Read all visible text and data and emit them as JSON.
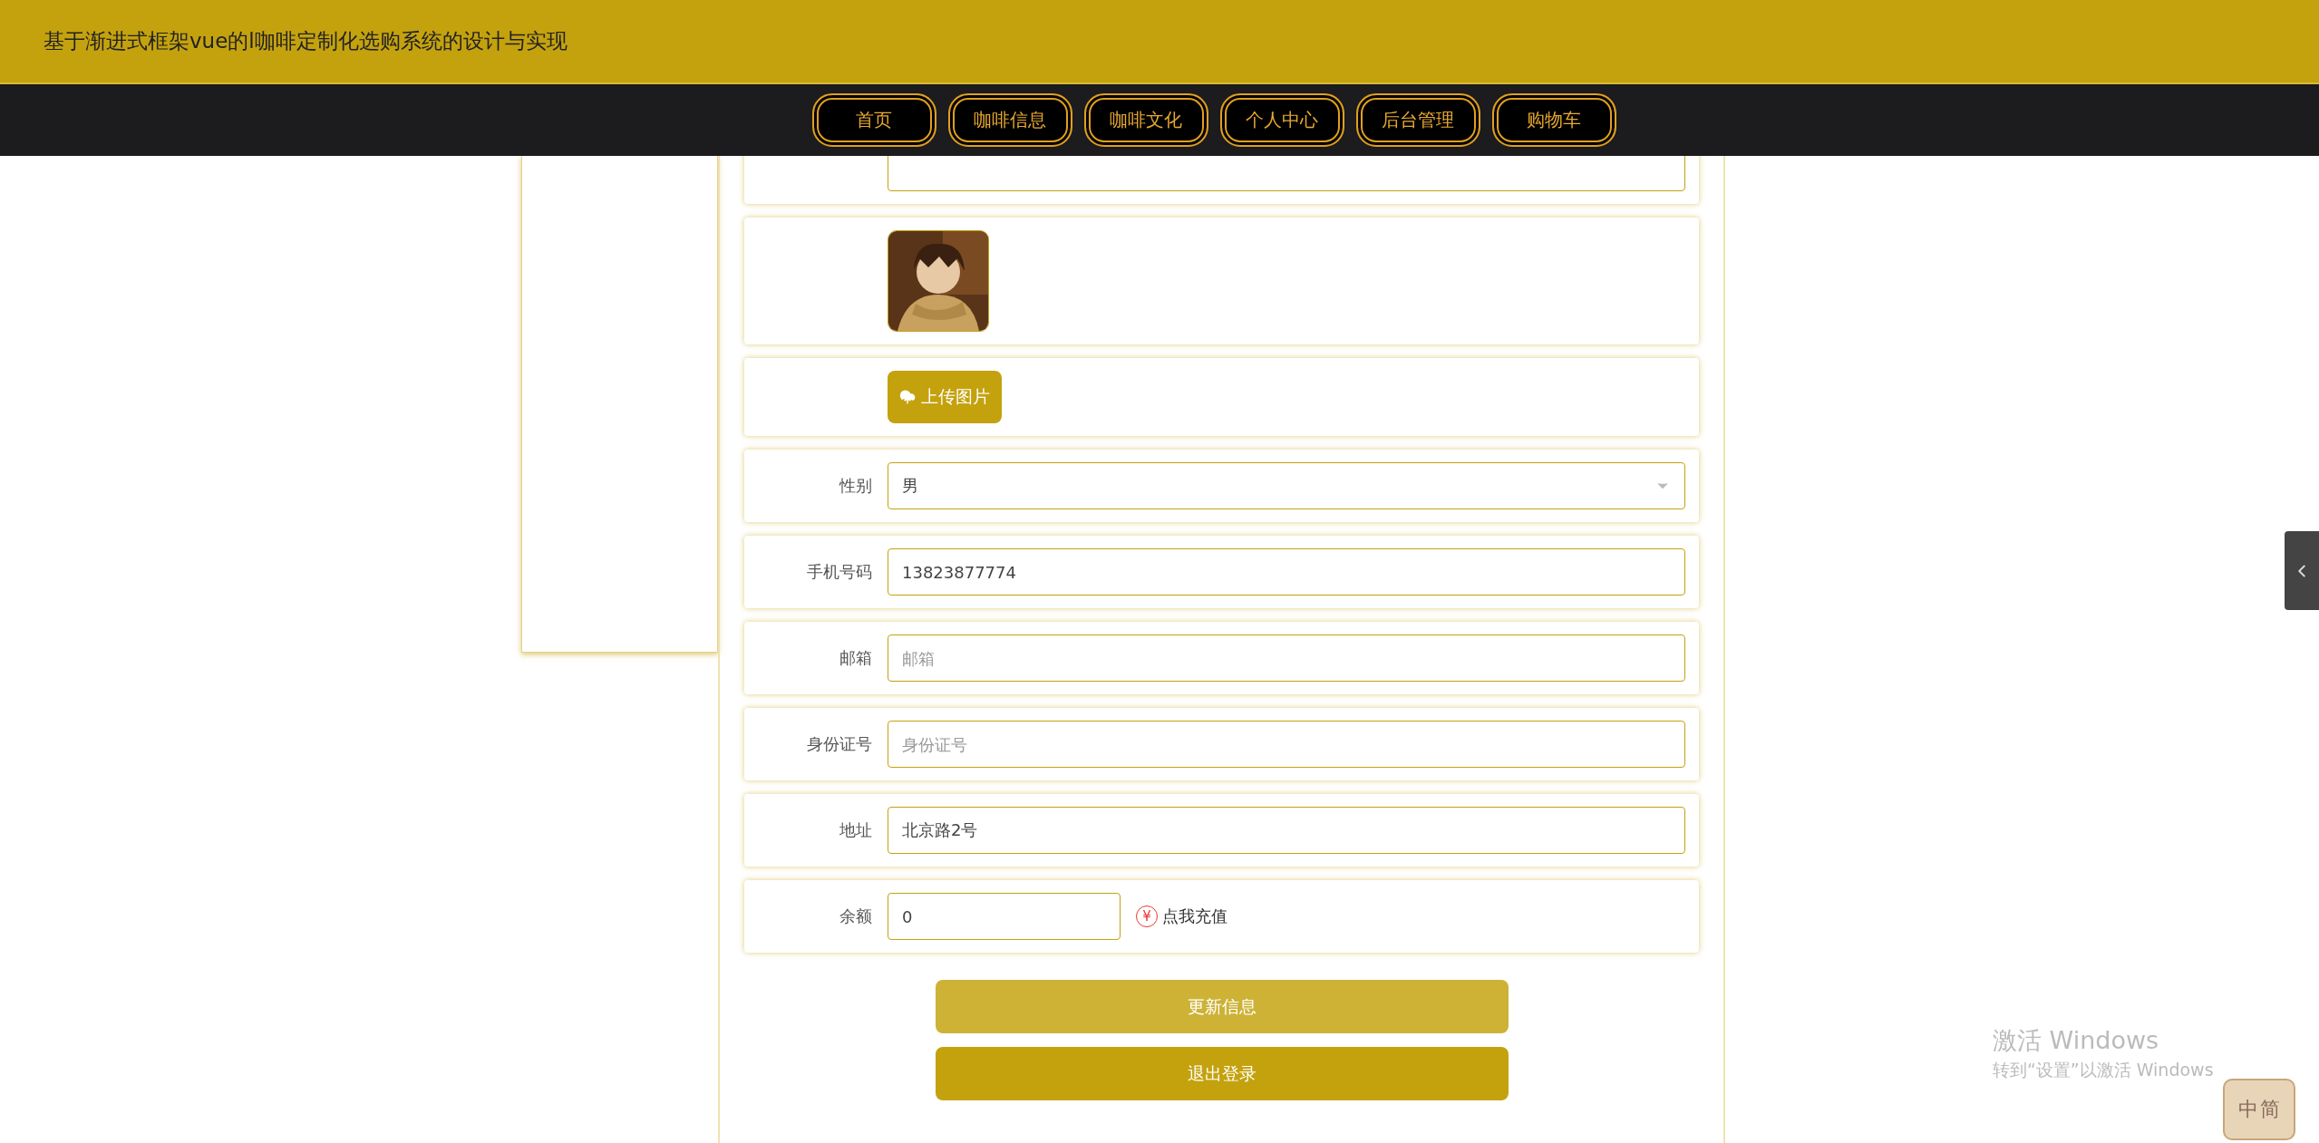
{
  "header": {
    "title": "基于渐进式框架vue的l咖啡定制化选购系统的设计与实现"
  },
  "nav": [
    {
      "label": "首页"
    },
    {
      "label": "咖啡信息"
    },
    {
      "label": "咖啡文化"
    },
    {
      "label": "个人中心"
    },
    {
      "label": "后台管理"
    },
    {
      "label": "购物车"
    }
  ],
  "form": {
    "rows": [
      {
        "kind": "input"
      },
      {
        "kind": "avatar"
      },
      {
        "kind": "upload",
        "button": "上传图片"
      },
      {
        "kind": "select",
        "label": "性别",
        "value": "男"
      },
      {
        "kind": "input",
        "label": "手机号码",
        "value": "13823877774"
      },
      {
        "kind": "input",
        "label": "邮箱",
        "placeholder": "邮箱"
      },
      {
        "kind": "input",
        "label": "身份证号",
        "placeholder": "身份证号"
      },
      {
        "kind": "input",
        "label": "地址",
        "value": "北京路2号"
      },
      {
        "kind": "balance",
        "label": "余额",
        "value": "0",
        "symbol": "¥",
        "link": "点我充值"
      }
    ]
  },
  "buttons": [
    {
      "label": "更新信息",
      "highlighted": true
    },
    {
      "label": "退出登录",
      "highlighted": false
    }
  ],
  "windows_notice": {
    "title": "激活 Windows",
    "text": "转到“设置”以激活 Windows"
  },
  "ime": {
    "labels": [
      "中",
      "简"
    ]
  }
}
